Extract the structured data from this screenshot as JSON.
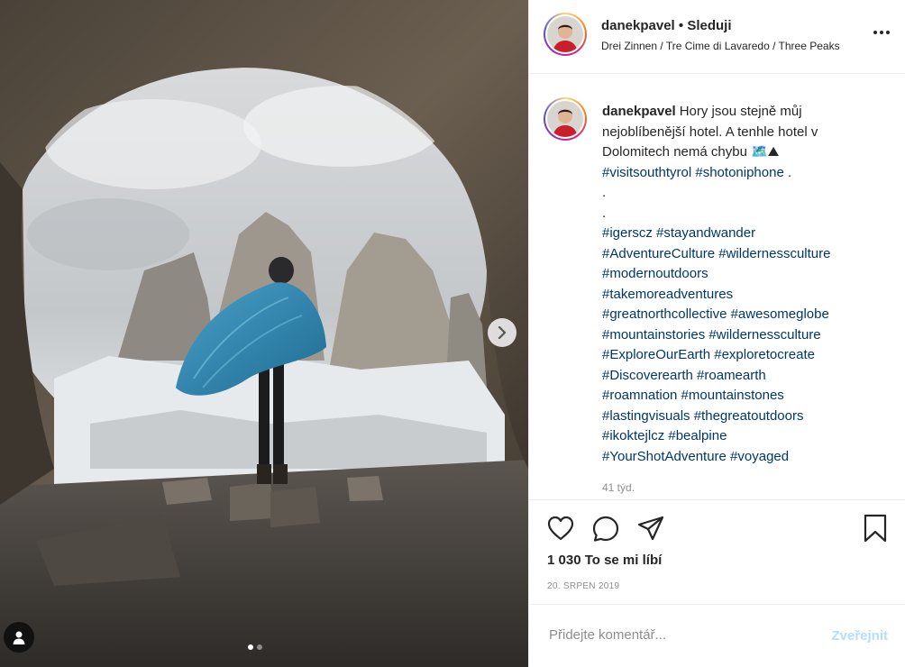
{
  "post": {
    "username": "danekpavel",
    "separator": "•",
    "follow_label": "Sleduji",
    "location": "Drei Zinnen / Tre Cime di Lavaredo / Three Peaks",
    "caption_lines": [
      "Hory jsou stejně můj",
      "nejoblíbenější hotel. A tenhle hotel v",
      "Dolomitech nemá chybu 🗺️⛰",
      "#visitsouthtyrol #shotoniphone .",
      ".",
      ".",
      "#igerscz #stayandwander",
      "#AdventureCulture #wildernessculture",
      "#modernoutdoors",
      "#takemoreadventures",
      "#greatnorthcollective #awesomeglobe",
      "#mountainstories #wildernessculture",
      "#ExploreOurEarth #exploretocreate",
      "#Discoverearth #roamearth",
      "#roamnation #mountainstones",
      "#lastingvisuals #thegreatoutdoors",
      "#ikoktejlcz #bealpine",
      "#YourShotAdventure #voyaged"
    ],
    "time_ago": "41 týd.",
    "likes": "1 030 To se mi líbí",
    "date": "20. SRPEN 2019",
    "comment_placeholder": "Přidejte komentář...",
    "post_button": "Zveřejnit"
  },
  "carousel": {
    "current": 1,
    "total": 2
  },
  "icons": {
    "like": "heart-icon",
    "comment": "comment-icon",
    "share": "share-icon",
    "save": "bookmark-icon",
    "more": "more-icon",
    "next": "chevron-right-icon",
    "tags": "user-tag-icon"
  },
  "colors": {
    "link": "#00376b",
    "post_button_disabled": "#b2dffc",
    "muted": "#8e8e8e"
  }
}
